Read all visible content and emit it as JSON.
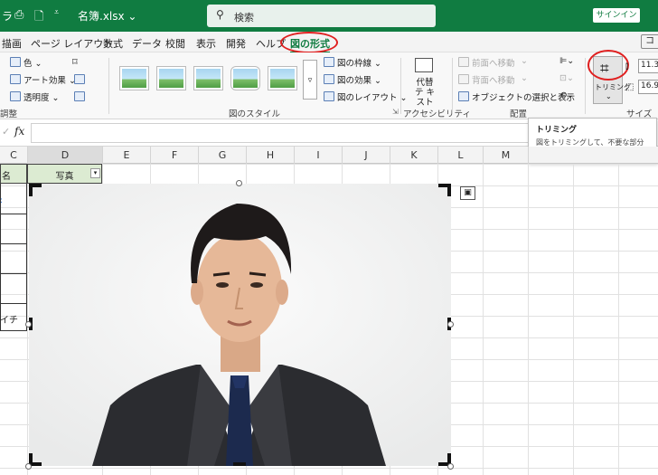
{
  "titlebar": {
    "left_fragment": "ラ",
    "filename": "名簿.xlsx ⌄",
    "search_placeholder": "検索",
    "signin": "サインイン"
  },
  "menubar": {
    "items": [
      "描画",
      "ページ レイアウト",
      "数式",
      "データ",
      "校閲",
      "表示",
      "開発",
      "ヘルプ",
      "図の形式"
    ],
    "active": "図の形式",
    "right_fragment": "コ"
  },
  "ribbon": {
    "adjust": {
      "color": "色 ⌄",
      "art_effects": "アート効果 ⌄",
      "transparency": "透明度 ⌄",
      "group_label": "調整"
    },
    "styles": {
      "border": "図の枠線 ⌄",
      "effects": "図の効果 ⌄",
      "layout": "図のレイアウト ⌄",
      "group_label": "図のスタイル"
    },
    "accessibility": {
      "alt_text": "代替テ キスト",
      "group_label": "アクセシビリティ"
    },
    "arrange": {
      "bring_forward": "前面へ移動",
      "send_backward": "背面へ移動",
      "selection_pane": "オブジェクトの選択と表示",
      "group_label": "配置"
    },
    "size": {
      "crop": "トリミング",
      "height": "11.3",
      "width": "16.9",
      "group_label": "サイズ"
    }
  },
  "formula": {
    "fx": "fx",
    "cancel": "✓"
  },
  "columns": [
    "C",
    "D",
    "E",
    "F",
    "G",
    "H",
    "I",
    "J",
    "K",
    "L",
    "M"
  ],
  "cells": {
    "c_header": "名",
    "d_header": "写真",
    "c_row8": "イチ"
  },
  "tooltip": {
    "title": "トリミング",
    "body": "図をトリミングして、不要な部分を取り除きます。"
  }
}
